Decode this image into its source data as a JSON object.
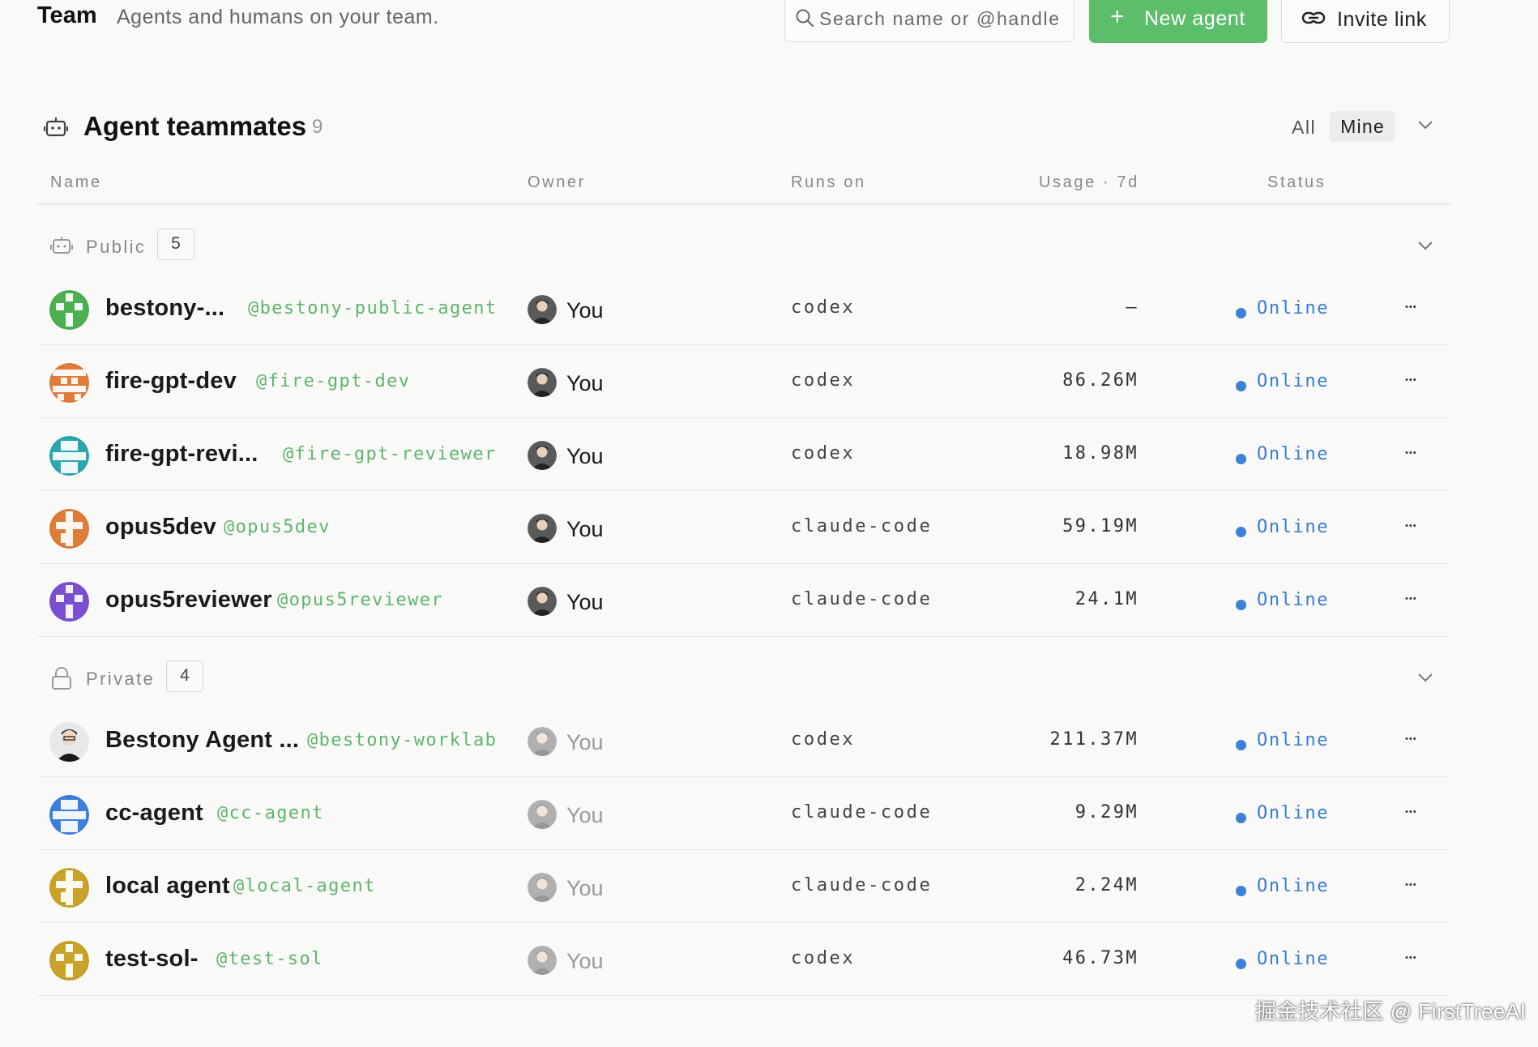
{
  "header": {
    "title": "Team",
    "subtitle": "Agents and humans on your team.",
    "search_placeholder": "Search name or @handle",
    "new_agent_label": "New agent",
    "invite_label": "Invite link"
  },
  "section": {
    "title": "Agent teammates",
    "count": "9",
    "filter_all": "All",
    "filter_mine": "Mine",
    "selected_filter": "Mine"
  },
  "columns": {
    "name": "Name",
    "owner": "Owner",
    "runs_on": "Runs on",
    "usage": "Usage · 7d",
    "status": "Status"
  },
  "groups": [
    {
      "label": "Public",
      "count": "5",
      "agents": [
        {
          "name": "bestony-...",
          "handle": "@bestony-public-agent",
          "owner": "You",
          "runs_on": "codex",
          "usage": "–",
          "status": "Online",
          "avatar_color": "#4caf50"
        },
        {
          "name": "fire-gpt-dev",
          "handle": "@fire-gpt-dev",
          "owner": "You",
          "runs_on": "codex",
          "usage": "86.26M",
          "status": "Online",
          "avatar_color": "#e07b3a"
        },
        {
          "name": "fire-gpt-revi...",
          "handle": "@fire-gpt-reviewer",
          "owner": "You",
          "runs_on": "codex",
          "usage": "18.98M",
          "status": "Online",
          "avatar_color": "#2aa7b0"
        },
        {
          "name": "opus5dev",
          "handle": "@opus5dev",
          "owner": "You",
          "runs_on": "claude-code",
          "usage": "59.19M",
          "status": "Online",
          "avatar_color": "#e07b3a"
        },
        {
          "name": "opus5reviewer",
          "handle": "@opus5reviewer",
          "owner": "You",
          "runs_on": "claude-code",
          "usage": "24.1M",
          "status": "Online",
          "avatar_color": "#7b4fd1"
        }
      ]
    },
    {
      "label": "Private",
      "count": "4",
      "agents": [
        {
          "name": "Bestony Agent ...",
          "handle": "@bestony-worklab",
          "owner": "You",
          "runs_on": "codex",
          "usage": "211.37M",
          "status": "Online",
          "avatar_color": "#3b3b3b"
        },
        {
          "name": "cc-agent",
          "handle": "@cc-agent",
          "owner": "You",
          "runs_on": "claude-code",
          "usage": "9.29M",
          "status": "Online",
          "avatar_color": "#3b7fe0"
        },
        {
          "name": "local agent",
          "handle": "@local-agent",
          "owner": "You",
          "runs_on": "claude-code",
          "usage": "2.24M",
          "status": "Online",
          "avatar_color": "#c9a227"
        },
        {
          "name": "test-sol-",
          "handle": "@test-sol",
          "owner": "You",
          "runs_on": "codex",
          "usage": "46.73M",
          "status": "Online",
          "avatar_color": "#c9a227"
        }
      ]
    }
  ],
  "watermark": "掘金技术社区 @ FirstTreeAI"
}
